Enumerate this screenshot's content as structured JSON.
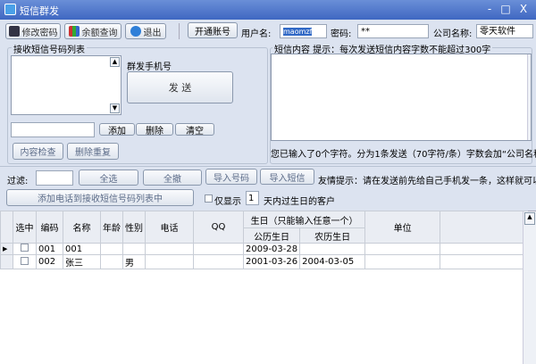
{
  "window": {
    "title": "短信群发",
    "controls": [
      "-",
      "□",
      "X"
    ]
  },
  "toolbar": {
    "change_password": "修改密码",
    "balance_query": "余额查询",
    "exit": "退出",
    "open_account": "开通账号",
    "username_label": "用户名:",
    "username_value": "maomzf",
    "password_label": "密码:",
    "password_value": "**",
    "company_label": "公司名称:",
    "company_value": "零天软件"
  },
  "recipients": {
    "title": "接收短信号码列表",
    "mass_label": "群发手机号",
    "send": "发 送",
    "add": "添加",
    "delete": "删除",
    "clear": "清空",
    "check_content": "内容检查",
    "remove_duplicates": "删除重复"
  },
  "message": {
    "title": "短信内容  提示：每次发送短信内容字数不能超过300字",
    "status": "您已输入了0个字符。分为1条发送（70字符/条）字数会加“公司名称”"
  },
  "filter": {
    "label": "过滤:",
    "select_all": "全选",
    "deselect_all": "全撤",
    "import_numbers": "导入号码",
    "import_sms": "导入短信",
    "tip": "友情提示：请在发送前先给自己手机发一条，这样就可以知",
    "add_to_list": "添加电话到接收短信号码列表中",
    "only_show": "仅显示",
    "days": "1",
    "birthday_suffix": "天内过生日的客户"
  },
  "grid": {
    "headers": {
      "selected": "选中",
      "code": "编码",
      "name": "名称",
      "age": "年龄",
      "gender": "性别",
      "phone": "电话",
      "qq": "QQ",
      "birthday": "生日（只能输入任意一个）",
      "solar": "公历生日",
      "lunar": "农历生日",
      "unit": "单位"
    },
    "rows": [
      {
        "code": "001",
        "name": "001",
        "age": "",
        "gender": "",
        "phone": "",
        "qq": "",
        "solar": "2009-03-28",
        "lunar": "",
        "unit": "",
        "checked": false,
        "current": true
      },
      {
        "code": "002",
        "name": "张三",
        "age": "",
        "gender": "男",
        "phone": "",
        "qq": "",
        "solar": "2001-03-26",
        "lunar": "2004-03-05",
        "unit": "",
        "checked": false,
        "current": false
      }
    ]
  }
}
